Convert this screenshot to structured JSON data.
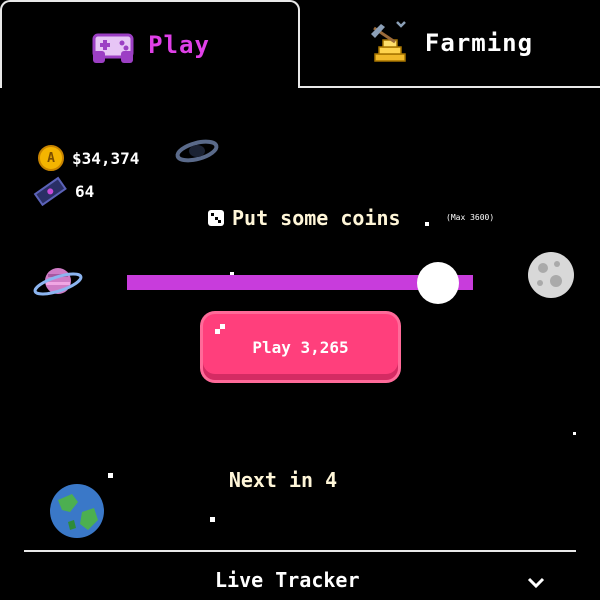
{
  "tabs": [
    {
      "label": "Play",
      "icon": "gamepad-icon",
      "active": true,
      "color": "#e040e8"
    },
    {
      "label": "Farming",
      "icon": "gold-pickaxe-icon",
      "active": false,
      "color": "#ffffff"
    }
  ],
  "stats": {
    "balance": "$34,374",
    "tickets": "64"
  },
  "bet": {
    "prompt": "Put some coins",
    "max_label": "(Max 3600)",
    "slider_level": 0.9,
    "slider_color": "#c83cdc"
  },
  "play_button": {
    "label": "Play 3,265",
    "color": "#ff3f7c"
  },
  "next_label": "Next in 4",
  "footer": {
    "title": "Live Tracker"
  }
}
